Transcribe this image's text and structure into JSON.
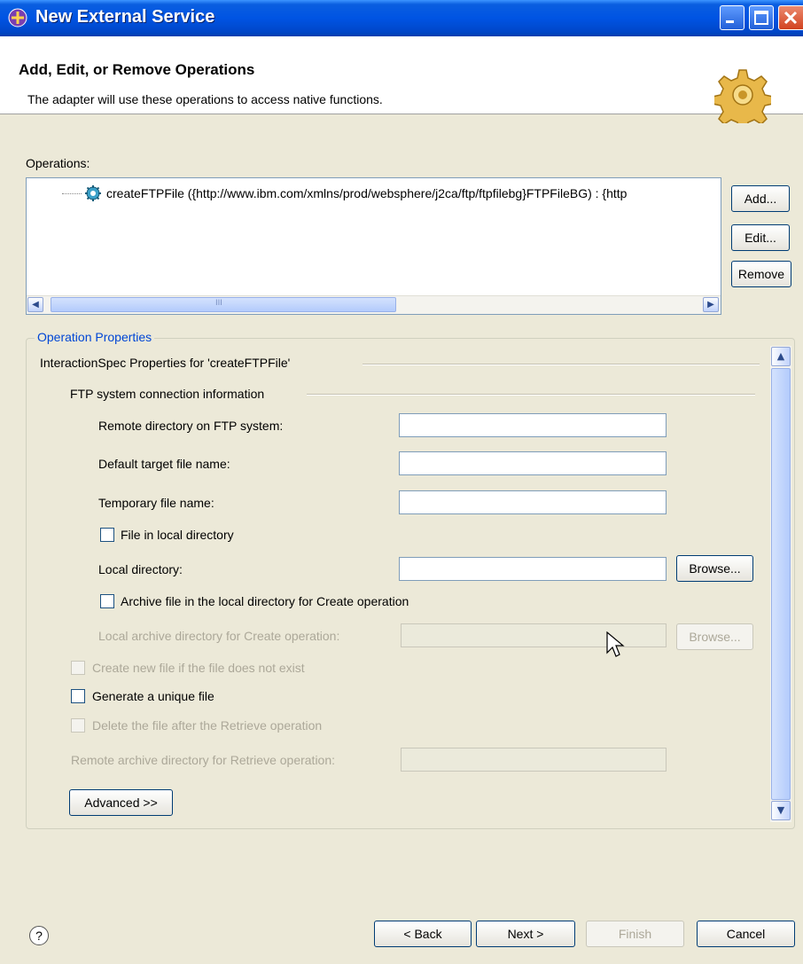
{
  "window": {
    "title": "New External Service"
  },
  "header": {
    "title": "Add, Edit, or Remove Operations",
    "description": "The adapter will use these operations to access native functions.",
    "icon": "gear-icon"
  },
  "operations": {
    "label": "Operations:",
    "items": [
      {
        "text": "createFTPFile ({http://www.ibm.com/xmlns/prod/websphere/j2ca/ftp/ftpfilebg}FTPFileBG) : {http",
        "icon": "operation-gear-icon"
      }
    ],
    "add_label": "Add...",
    "edit_label": "Edit...",
    "remove_label": "Remove",
    "scroll_grip": "III"
  },
  "properties": {
    "legend": "Operation Properties",
    "interaction_heading": "InteractionSpec Properties for 'createFTPFile'",
    "ftp_heading": "FTP system connection information",
    "remote_dir_label": "Remote directory on FTP system:",
    "default_target_label": "Default target file name:",
    "temp_file_label": "Temporary file name:",
    "file_in_local_label": "File in local directory",
    "local_dir_label": "Local directory:",
    "browse_label": "Browse...",
    "archive_label": "Archive file in the local directory for Create operation",
    "local_archive_label": "Local archive directory for Create operation:",
    "browse2_label": "Browse...",
    "create_new_label": "Create new file if the file does not exist",
    "generate_unique_label": "Generate a unique file",
    "delete_after_label": "Delete the file after the Retrieve operation",
    "remote_archive_label": "Remote archive directory for Retrieve operation:",
    "advanced_label": "Advanced >>"
  },
  "footer": {
    "help": "?",
    "back_label": "< Back",
    "next_label": "Next >",
    "finish_label": "Finish",
    "cancel_label": "Cancel"
  }
}
